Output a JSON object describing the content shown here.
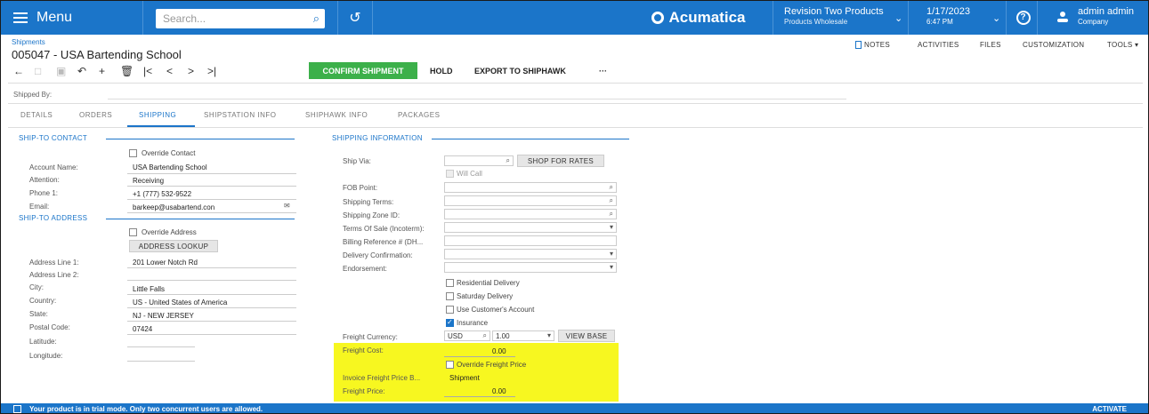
{
  "topbar": {
    "menu_label": "Menu",
    "search_placeholder": "Search...",
    "brand": "Acumatica",
    "company": "Revision Two Products",
    "company_sub": "Products Wholesale",
    "date": "1/17/2023",
    "time": "6:47 PM",
    "user": "admin admin",
    "user_sub": "Company"
  },
  "header": {
    "breadcrumb": "Shipments",
    "title": "005047 - USA Bartending School",
    "links": {
      "notes": "NOTES",
      "activities": "ACTIVITIES",
      "files": "FILES",
      "customization": "CUSTOMIZATION",
      "tools": "TOOLS"
    }
  },
  "toolbar": {
    "confirm": "CONFIRM SHIPMENT",
    "hold": "HOLD",
    "export": "EXPORT TO SHIPHAWK",
    "more": "···"
  },
  "shipped_by_label": "Shipped By:",
  "tabs": [
    "DETAILS",
    "ORDERS",
    "SHIPPING",
    "SHIPSTATION INFO",
    "SHIPHAWK INFO",
    "PACKAGES"
  ],
  "active_tab": "SHIPPING",
  "ship_to_contact": {
    "title": "SHIP-TO CONTACT",
    "override_label": "Override Contact",
    "account_name_label": "Account Name:",
    "account_name": "USA Bartending School",
    "attention_label": "Attention:",
    "attention": "Receiving",
    "phone_label": "Phone 1:",
    "phone": "+1 (777) 532-9522",
    "email_label": "Email:",
    "email": "barkeep@usabartend.con"
  },
  "ship_to_address": {
    "title": "SHIP-TO ADDRESS",
    "override_label": "Override Address",
    "lookup_button": "ADDRESS LOOKUP",
    "line1_label": "Address Line 1:",
    "line1": "201 Lower Notch Rd",
    "line2_label": "Address Line 2:",
    "line2": "",
    "city_label": "City:",
    "city": "Little Falls",
    "country_label": "Country:",
    "country": "US - United States of America",
    "state_label": "State:",
    "state": "NJ - NEW JERSEY",
    "postal_label": "Postal Code:",
    "postal": "07424",
    "latitude_label": "Latitude:",
    "longitude_label": "Longitude:"
  },
  "shipping_info": {
    "title": "SHIPPING INFORMATION",
    "ship_via_label": "Ship Via:",
    "shop_rates_button": "SHOP FOR RATES",
    "will_call_label": "Will Call",
    "fob_label": "FOB Point:",
    "terms_label": "Shipping Terms:",
    "zone_label": "Shipping Zone ID:",
    "incoterm_label": "Terms Of Sale (Incoterm):",
    "billing_ref_label": "Billing Reference # (DH...",
    "delivery_conf_label": "Delivery Confirmation:",
    "endorsement_label": "Endorsement:",
    "residential_label": "Residential Delivery",
    "saturday_label": "Saturday Delivery",
    "customer_account_label": "Use Customer's Account",
    "insurance_label": "Insurance",
    "freight_currency_label": "Freight Currency:",
    "currency": "USD",
    "rate": "1.00",
    "view_base_button": "VIEW BASE",
    "freight_cost_label": "Freight Cost:",
    "freight_cost": "0.00",
    "override_freight_label": "Override Freight Price",
    "invoice_freight_label": "Invoice Freight Price B...",
    "invoice_freight": "Shipment",
    "freight_price_label": "Freight Price:",
    "freight_price": "0.00"
  },
  "bottombar": {
    "message": "Your product is in trial mode. Only two concurrent users are allowed.",
    "activate": "ACTIVATE"
  }
}
